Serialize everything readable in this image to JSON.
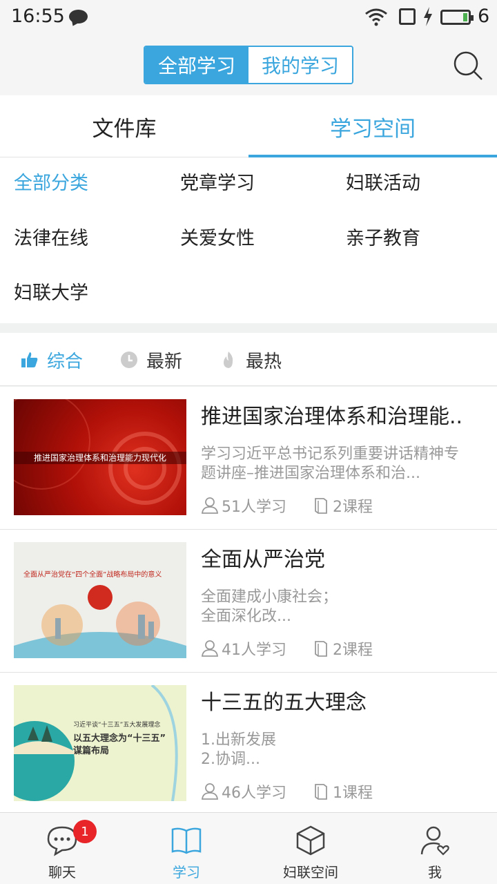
{
  "status_bar": {
    "time": "16:55",
    "battery_level": "6"
  },
  "header": {
    "segment": [
      "全部学习",
      "我的学习"
    ],
    "active_segment": 0
  },
  "main_tabs": [
    "文件库",
    "学习空间"
  ],
  "active_main_tab": 1,
  "categories": [
    "全部分类",
    "党章学习",
    "妇联活动",
    "法律在线",
    "关爱女性",
    "亲子教育",
    "妇联大学"
  ],
  "active_category": 0,
  "sort": {
    "items": [
      {
        "label": "综合",
        "icon": "thumbs-up-icon"
      },
      {
        "label": "最新",
        "icon": "clock-icon"
      },
      {
        "label": "最热",
        "icon": "flame-icon"
      }
    ],
    "active": 0
  },
  "courses": [
    {
      "title": "推进国家治理体系和治理能..",
      "desc_line1": "学习习近平总书记系列重要讲话精神专",
      "desc_line2": "题讲座–推进国家治理体系和治...",
      "learners": "51人学习",
      "lessons": "2课程",
      "thumb_text": "推进国家治理体系和治理能力现代化"
    },
    {
      "title": "全面从严治党",
      "desc_line1": "全面建成小康社会；",
      "desc_line2": "全面深化改...",
      "learners": "41人学习",
      "lessons": "2课程",
      "thumb_text": "全面从严治党在“四个全面”战略布局中的意义"
    },
    {
      "title": "十三五的五大理念",
      "desc_line1": "1.出新发展",
      "desc_line2": "2.协调...",
      "learners": "46人学习",
      "lessons": "1课程",
      "thumb_text_a": "习近平谈“十三五”五大发展理念",
      "thumb_text_b": "以五大理念为“十三五”",
      "thumb_text_c": "谋篇布局"
    }
  ],
  "bottom_nav": [
    {
      "label": "聊天",
      "icon": "chat-icon",
      "badge": "1"
    },
    {
      "label": "学习",
      "icon": "book-icon"
    },
    {
      "label": "妇联空间",
      "icon": "cube-icon"
    },
    {
      "label": "我",
      "icon": "user-heart-icon"
    }
  ],
  "active_nav": 1,
  "colors": {
    "accent": "#3aa6dd",
    "badge": "#e8262a"
  }
}
